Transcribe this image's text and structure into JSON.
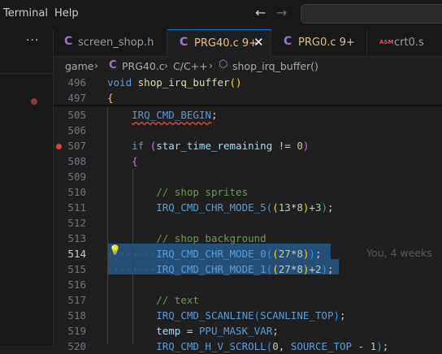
{
  "menu": {
    "terminal": "Terminal",
    "help": "Help"
  },
  "nav": {
    "back": "←",
    "forward": "→"
  },
  "sidebar": {
    "more": "···"
  },
  "tabs": [
    {
      "icon": "C",
      "label": "screen_shop.h"
    },
    {
      "icon": "C",
      "label": "PRG40.c 9+",
      "close": "✕"
    },
    {
      "icon": "C",
      "label": "PRG0.c 9+"
    },
    {
      "icon": "ASM",
      "label": "crt0.s"
    }
  ],
  "breadcrumb": {
    "folder": "game",
    "file_icon": "C",
    "file": "PRG40.c",
    "lang": "C/C++",
    "symbol_icon": "⬡",
    "symbol": "shop_irq_buffer()",
    "sep": "›"
  },
  "colors": {
    "accent": "#0078d4",
    "selection": "#264f78",
    "breakpoint": "#c74e39"
  },
  "editor": {
    "lines": [
      {
        "n": "496",
        "t": [
          [
            "void",
            "kw"
          ],
          [
            " ",
            "tx"
          ],
          [
            "shop_irq_buffer",
            "fn"
          ],
          [
            "()",
            "p1"
          ]
        ]
      },
      {
        "n": "497",
        "t": [
          [
            "{",
            "p1"
          ]
        ]
      },
      {
        "n": "505",
        "t": [
          [
            "    ",
            "tx"
          ],
          [
            "IRQ_CMD_BEGIN",
            "mac squig"
          ],
          [
            ";",
            "tx"
          ]
        ]
      },
      {
        "n": "506",
        "t": []
      },
      {
        "n": "507",
        "t": [
          [
            "    ",
            "tx"
          ],
          [
            "if",
            "kw"
          ],
          [
            " ",
            "tx"
          ],
          [
            "(",
            "p2"
          ],
          [
            "star_time_remaining",
            "var"
          ],
          [
            " != ",
            "tx"
          ],
          [
            "0",
            "num"
          ],
          [
            ")",
            "p2"
          ]
        ]
      },
      {
        "n": "508",
        "t": [
          [
            "    ",
            "tx"
          ],
          [
            "{",
            "p2"
          ]
        ]
      },
      {
        "n": "509",
        "t": []
      },
      {
        "n": "510",
        "t": [
          [
            "        ",
            "tx"
          ],
          [
            "// shop sprites",
            "cm"
          ]
        ]
      },
      {
        "n": "511",
        "t": [
          [
            "        ",
            "tx"
          ],
          [
            "IRQ_CMD_CHR_MODE_5",
            "mac"
          ],
          [
            "(",
            "p3"
          ],
          [
            "(",
            "p1"
          ],
          [
            "13",
            "num"
          ],
          [
            "*",
            "tx"
          ],
          [
            "8",
            "num"
          ],
          [
            ")",
            "p1"
          ],
          [
            "+",
            "tx"
          ],
          [
            "3",
            "num"
          ],
          [
            ")",
            "p3"
          ],
          [
            ";",
            "tx"
          ]
        ]
      },
      {
        "n": "512",
        "t": []
      },
      {
        "n": "513",
        "t": [
          [
            "        ",
            "tx"
          ],
          [
            "// shop background",
            "cm"
          ]
        ]
      },
      {
        "n": "514",
        "t": [
          [
            "        ",
            "tx"
          ],
          [
            "IRQ_CMD_CHR_MODE_0",
            "mac"
          ],
          [
            "(",
            "p3"
          ],
          [
            "(",
            "p1"
          ],
          [
            "27",
            "num"
          ],
          [
            "*",
            "tx"
          ],
          [
            "8",
            "num"
          ],
          [
            ")",
            "p1"
          ],
          [
            ")",
            "p3"
          ],
          [
            ";",
            "tx"
          ]
        ]
      },
      {
        "n": "515",
        "t": [
          [
            "        ",
            "tx"
          ],
          [
            "IRQ_CMD_CHR_MODE_1",
            "mac"
          ],
          [
            "(",
            "p3"
          ],
          [
            "(",
            "p1"
          ],
          [
            "27",
            "num"
          ],
          [
            "*",
            "tx"
          ],
          [
            "8",
            "num"
          ],
          [
            ")",
            "p1"
          ],
          [
            "+",
            "tx"
          ],
          [
            "2",
            "num"
          ],
          [
            ")",
            "p3"
          ],
          [
            ";",
            "tx"
          ]
        ]
      },
      {
        "n": "516",
        "t": []
      },
      {
        "n": "517",
        "t": [
          [
            "        ",
            "tx"
          ],
          [
            "// text",
            "cm"
          ]
        ]
      },
      {
        "n": "518",
        "t": [
          [
            "        ",
            "tx"
          ],
          [
            "IRQ_CMD_SCANLINE",
            "mac"
          ],
          [
            "(",
            "p3"
          ],
          [
            "SCANLINE_TOP",
            "mac"
          ],
          [
            ")",
            "p3"
          ],
          [
            ";",
            "tx"
          ]
        ]
      },
      {
        "n": "519",
        "t": [
          [
            "        ",
            "tx"
          ],
          [
            "temp",
            "var"
          ],
          [
            " = ",
            "tx"
          ],
          [
            "PPU_MASK_VAR",
            "mac"
          ],
          [
            ";",
            "tx"
          ]
        ]
      },
      {
        "n": "520",
        "t": [
          [
            "        ",
            "tx"
          ],
          [
            "IRQ_CMD_H_V_SCROLL",
            "mac"
          ],
          [
            "(",
            "p3"
          ],
          [
            "0",
            "num"
          ],
          [
            ", ",
            "tx"
          ],
          [
            "SOURCE_TOP",
            "mac"
          ],
          [
            " - ",
            "tx"
          ],
          [
            "1",
            "num"
          ],
          [
            ")",
            "p3"
          ],
          [
            ";",
            "tx"
          ]
        ]
      }
    ],
    "current_line": "514",
    "blame": "You, 4 weeks"
  }
}
